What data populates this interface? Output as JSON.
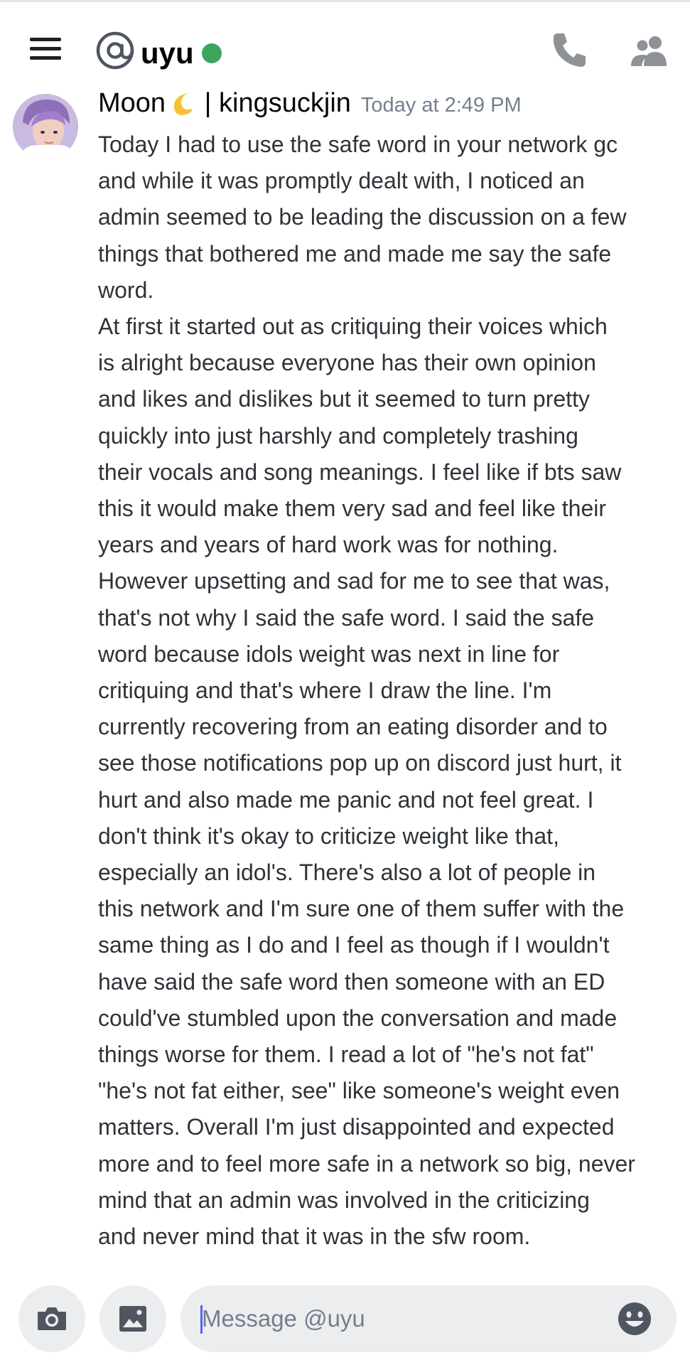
{
  "header": {
    "channel_name": "uyu",
    "status": "online",
    "status_color": "#3ba55d"
  },
  "message": {
    "author_name": "Moon",
    "author_emoji": "crescent-moon-icon",
    "author_suffix": " | kingsuckjin",
    "timestamp": "Today at 2:49 PM",
    "lines": [
      "Today I had to use the safe word in your network gc",
      "and while it was promptly dealt with, I noticed an",
      "admin seemed to be leading the discussion on a few",
      "things that bothered me and made me say the safe",
      "word.",
      "At first it started out as critiquing their voices which",
      "is alright because everyone has their own opinion",
      "and likes and dislikes but it seemed to turn pretty",
      "quickly into just harshly and completely trashing",
      "their vocals and song meanings. I feel like if bts saw",
      "this it would make them very sad and feel like their",
      "years and years of hard work was for nothing.",
      "However upsetting and sad for me to see that was,",
      "that's not why I said the safe word. I said the safe",
      "word because idols weight was next in line for",
      "critiquing and that's where I draw the line. I'm",
      "currently recovering from an eating disorder and to",
      "see those notifications pop up on discord just hurt, it",
      "hurt and also made me panic and not feel great. I",
      "don't think it's okay to criticize weight like that,",
      "especially an idol's. There's also a lot of people in",
      "this network and I'm sure one of them suffer with the",
      "same thing as I do and I feel as though if I wouldn't",
      "have said the safe word then someone with an ED",
      "could've stumbled upon the conversation and made",
      "things worse for them. I read a lot of \"he's not fat\"",
      "\"he's not fat either, see\" like someone's weight even",
      "matters. Overall I'm just disappointed and expected",
      "more and to feel more safe in a network so big, never",
      "mind that an admin was involved in the criticizing",
      "and never mind that it was in the sfw room."
    ]
  },
  "composer": {
    "placeholder": "Message @uyu"
  },
  "icons": {
    "menu": "hamburger-menu-icon",
    "at": "at-sign-icon",
    "call": "phone-icon",
    "members": "members-icon",
    "camera": "camera-icon",
    "gallery": "image-icon",
    "emoji": "emoji-icon"
  },
  "colors": {
    "accent": "#5865f2",
    "online": "#3ba55d",
    "timestamp": "#747f8d",
    "text": "#2e3338"
  }
}
